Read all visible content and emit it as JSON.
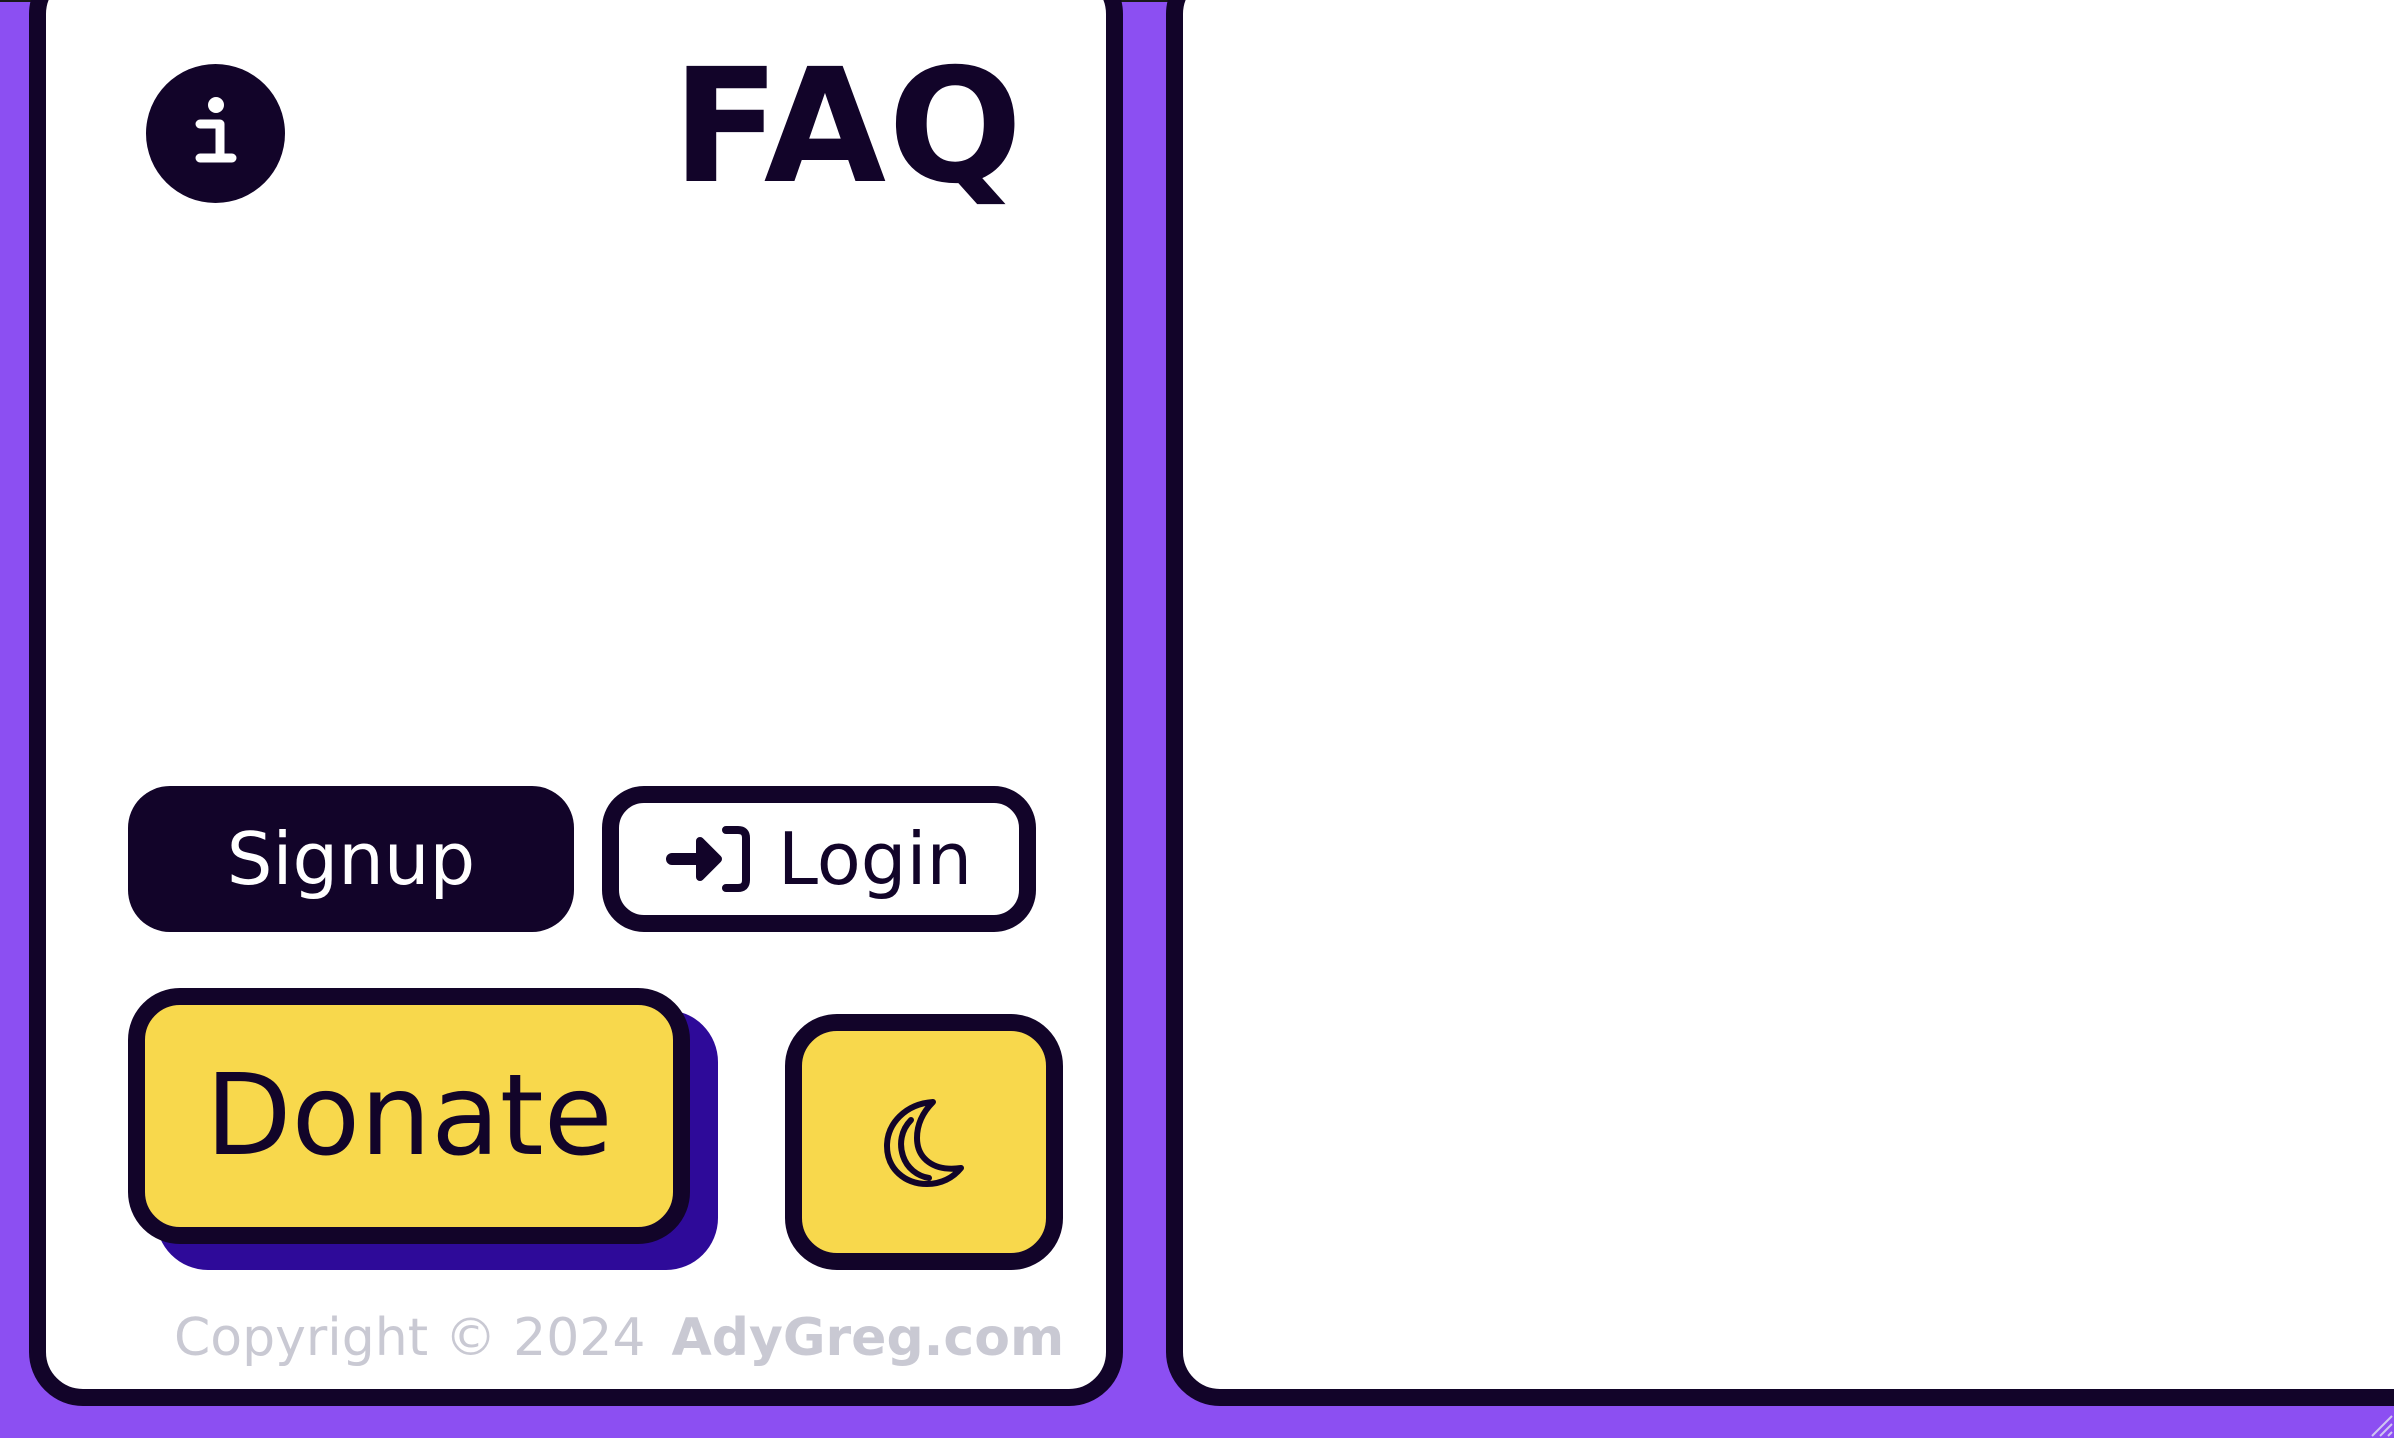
{
  "sidebar": {
    "title": "FAQ",
    "info_icon": "info-icon",
    "signup_label": "Signup",
    "login_label": "Login",
    "login_icon": "login-arrow-icon",
    "donate_label": "Donate",
    "theme_icon": "moon-icon",
    "copyright_text": "Copyright © 2024",
    "site_name": "AdyGreg.com"
  },
  "colors": {
    "background": "#8c4ff2",
    "panel": "#ffffff",
    "outline": "#120429",
    "accent_yellow": "#f8d84c",
    "shadow_indigo": "#2e0a99",
    "muted_text": "#c9c9d3"
  }
}
